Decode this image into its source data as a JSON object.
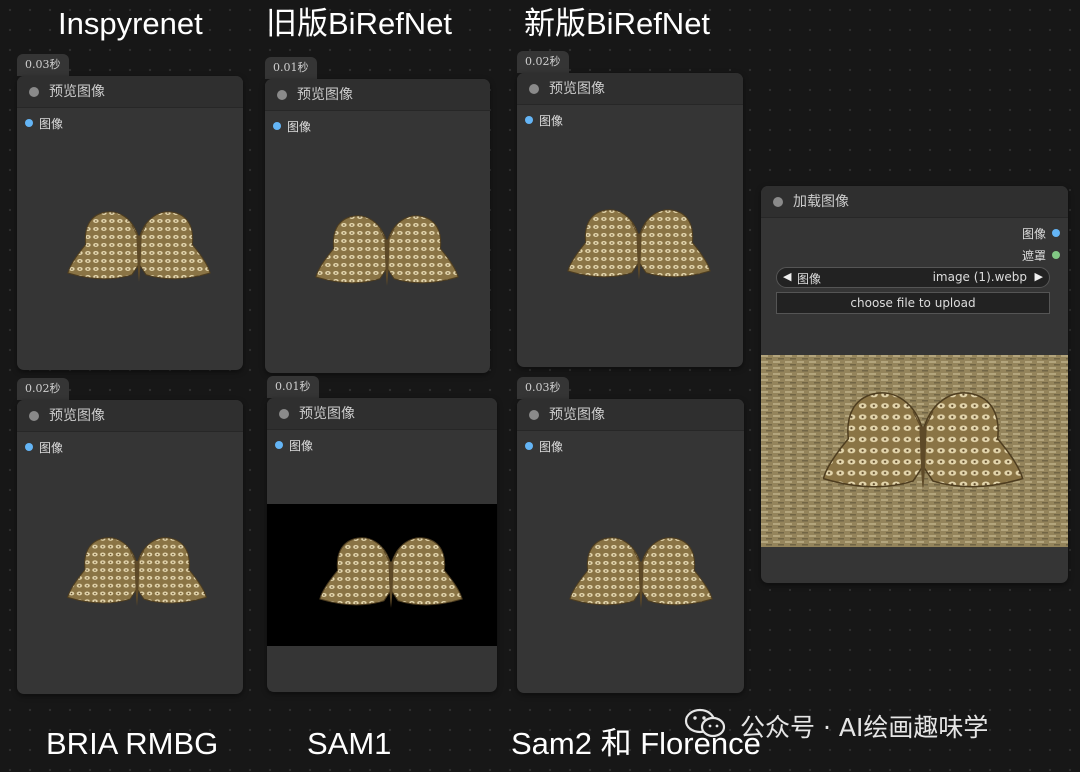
{
  "titles": {
    "top_1": "Inspyrenet",
    "top_2": "旧版BiRefNet",
    "top_3": "新版BiRefNet",
    "bottom_1": "BRIA RMBG",
    "bottom_2": "SAM1",
    "bottom_3": "Sam2 和 Florence"
  },
  "preview_nodes": [
    {
      "time": "0.03秒",
      "title": "预览图像",
      "slot": "图像"
    },
    {
      "time": "0.01秒",
      "title": "预览图像",
      "slot": "图像"
    },
    {
      "time": "0.02秒",
      "title": "预览图像",
      "slot": "图像"
    },
    {
      "time": "0.02秒",
      "title": "预览图像",
      "slot": "图像"
    },
    {
      "time": "0.01秒",
      "title": "预览图像",
      "slot": "图像"
    },
    {
      "time": "0.03秒",
      "title": "预览图像",
      "slot": "图像"
    }
  ],
  "load_node": {
    "title": "加载图像",
    "output_image": "图像",
    "output_mask": "遮罩",
    "widget_label": "图像",
    "widget_value": "image (1).webp",
    "upload_label": "choose file to upload"
  },
  "watermark": "公众号 · AI绘画趣味学",
  "colors": {
    "image_slot": "#64b5f6",
    "mask_slot": "#81c784",
    "canvas_bg": "#171717",
    "node_bg": "#353535"
  }
}
